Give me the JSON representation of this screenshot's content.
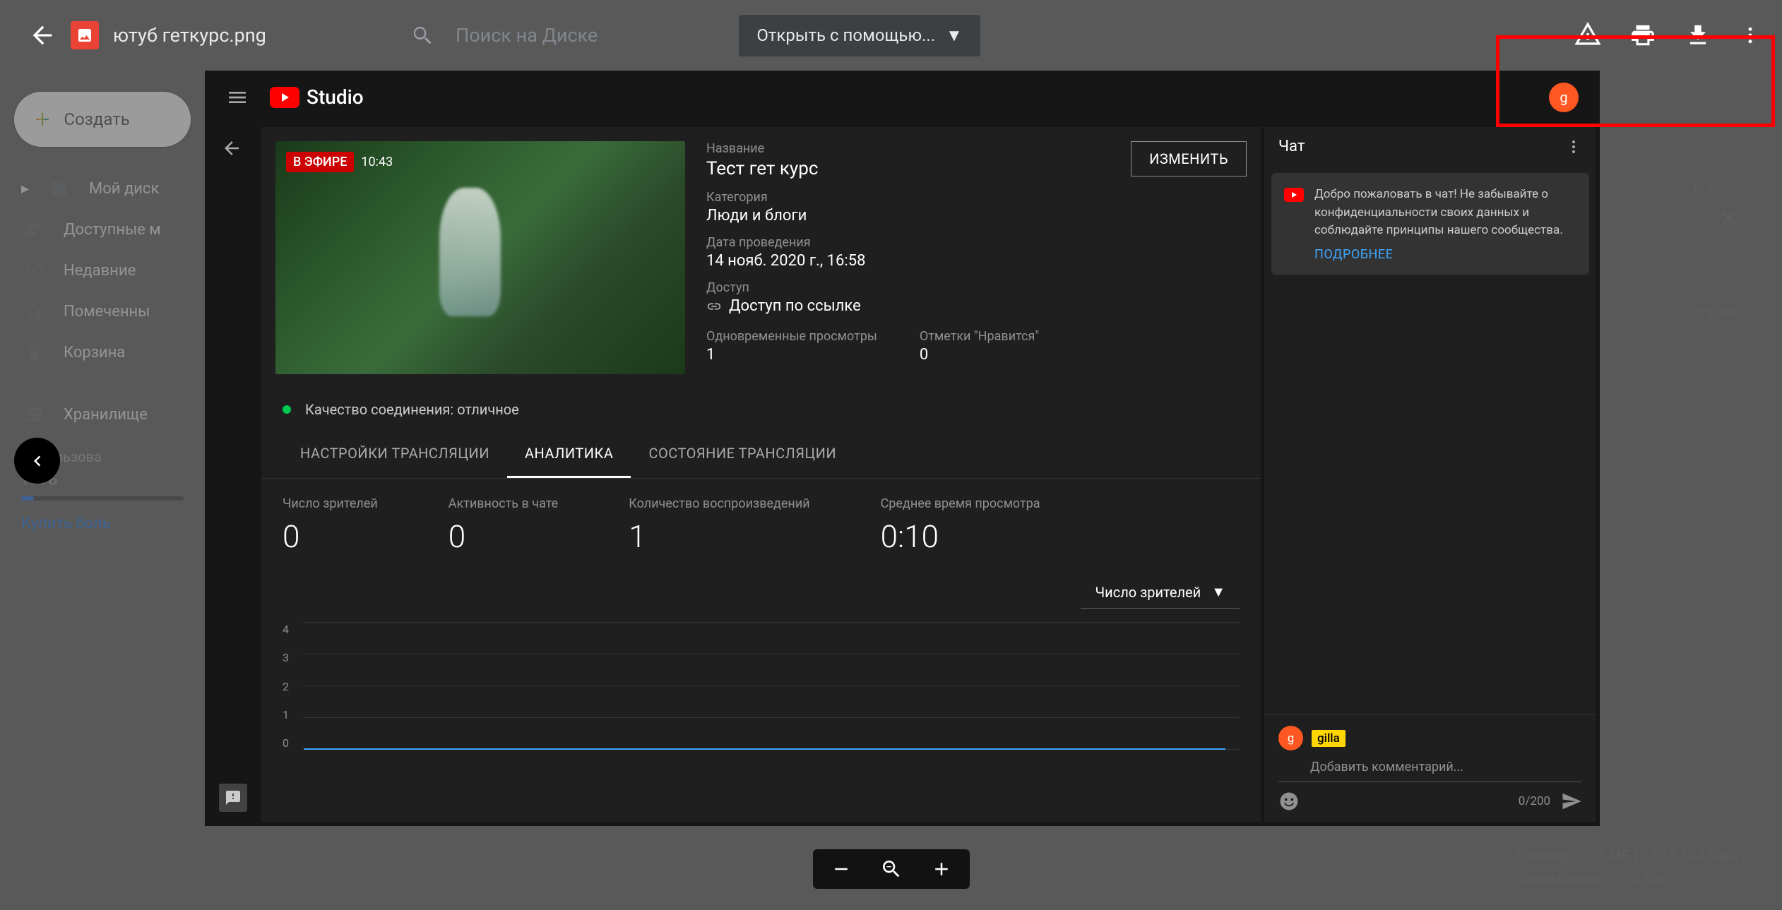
{
  "drive": {
    "file_name": "ютуб геткурс.png",
    "search_placeholder": "Поиск на Диске",
    "open_with": "Открыть с помощью...",
    "create_button": "Создать",
    "sidebar_items": [
      {
        "label": "Мой диск"
      },
      {
        "label": "Доступные м"
      },
      {
        "label": "Недавние"
      },
      {
        "label": "Помеченны"
      },
      {
        "label": "Корзина"
      },
      {
        "label": "Хранилище"
      }
    ],
    "storage_used": "Использова",
    "storage_total": "15 ГБ",
    "buy_more": "Купить боль"
  },
  "right_panel": {
    "item1": "С В",
    "item2": "тория",
    "size_label": "Размер",
    "size_value": "2 МБ (2 125 194 байта)",
    "occupies_label": "Занимаемое",
    "occupies_value": "0 байт"
  },
  "studio": {
    "brand": "Studio",
    "avatar_letter": "g",
    "live_tag": "В ЭФИРЕ",
    "timestamp": "10:43",
    "title_label": "Название",
    "title_value": "Тест гет курс",
    "category_label": "Категория",
    "category_value": "Люди и блоги",
    "date_label": "Дата проведения",
    "date_value": "14 нояб. 2020 г., 16:58",
    "access_label": "Доступ",
    "access_value": "Доступ по ссылке",
    "concurrent_label": "Одновременные просмотры",
    "concurrent_value": "1",
    "likes_label": "Отметки \"Нравится\"",
    "likes_value": "0",
    "edit_button": "ИЗМЕНИТЬ",
    "quality": "Качество соединения: отличное",
    "tabs": [
      {
        "label": "НАСТРОЙКИ ТРАНСЛЯЦИИ"
      },
      {
        "label": "АНАЛИТИКА"
      },
      {
        "label": "СОСТОЯНИЕ ТРАНСЛЯЦИИ"
      }
    ],
    "metrics": [
      {
        "label": "Число зрителей",
        "value": "0"
      },
      {
        "label": "Активность в чате",
        "value": "0"
      },
      {
        "label": "Количество воспроизведений",
        "value": "1"
      },
      {
        "label": "Среднее время просмотра",
        "value": "0:10"
      }
    ],
    "chart_select": "Число зрителей"
  },
  "chat": {
    "header": "Чат",
    "welcome": "Добро пожаловать в чат! Не забывайте о конфиденциальности своих данных и соблюдайте принципы нашего сообщества.",
    "learn_more": "ПОДРОБНЕЕ",
    "username": "gilla",
    "input_placeholder": "Добавить комментарий...",
    "char_count": "0/200"
  },
  "chart_data": {
    "type": "line",
    "title": "Число зрителей",
    "ylabel": "",
    "xlabel": "",
    "ylim": [
      0,
      4
    ],
    "y_ticks": [
      0,
      1,
      2,
      3,
      4
    ],
    "series": [
      {
        "name": "Число зрителей",
        "values": [
          0,
          0,
          0,
          0,
          0,
          0,
          0,
          0,
          0,
          0
        ]
      }
    ]
  }
}
